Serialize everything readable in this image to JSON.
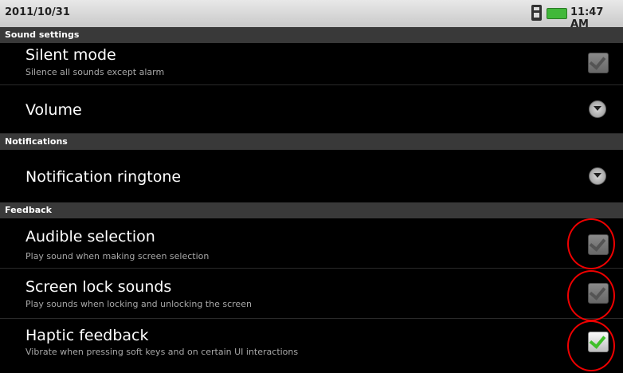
{
  "statusbar": {
    "date": "2011/10/31",
    "time": "11:47 AM",
    "icons": [
      "sim-icon",
      "battery-icon"
    ]
  },
  "sections": {
    "sound_settings": "Sound settings",
    "notifications": "Notifications",
    "feedback": "Feedback"
  },
  "prefs": {
    "silent_mode": {
      "title": "Silent mode",
      "summary": "Silence all sounds except alarm",
      "checked": true,
      "enabled": false
    },
    "volume": {
      "title": "Volume"
    },
    "notification_ringtone": {
      "title": "Notification ringtone"
    },
    "audible_selection": {
      "title": "Audible selection",
      "summary": "Play sound when making screen selection",
      "checked": true,
      "enabled": false
    },
    "screen_lock_sounds": {
      "title": "Screen lock sounds",
      "summary": "Play sounds when locking and unlocking the screen",
      "checked": true,
      "enabled": false
    },
    "haptic_feedback": {
      "title": "Haptic feedback",
      "summary": "Vibrate when pressing soft keys and on certain UI interactions",
      "checked": true,
      "enabled": true
    }
  },
  "colors": {
    "accent_check": "#3fbf2a",
    "highlight_circle": "#e00000",
    "header_bg": "#393939"
  }
}
